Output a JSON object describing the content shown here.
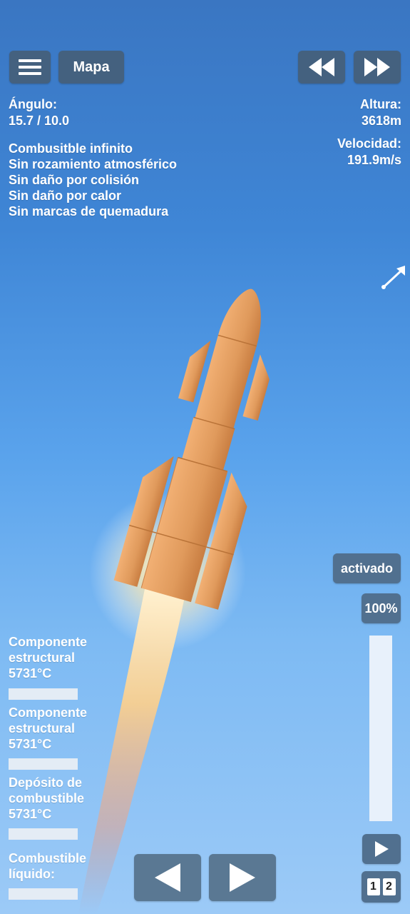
{
  "header": {
    "map_label": "Mapa"
  },
  "left_info": {
    "angle_label": "Ángulo:",
    "angle_value": "15.7 / 10.0",
    "cheats": [
      "Combusitble infinito",
      "Sin rozamiento atmosférico",
      "Sin daño por colisión",
      "Sin daño por calor",
      "Sin marcas de quemadura"
    ]
  },
  "right_info": {
    "altitude_label": "Altura:",
    "altitude_value": "3618m",
    "velocity_label": "Velocidad:",
    "velocity_value": "191.9m/s"
  },
  "controls": {
    "activated_label": "activado",
    "throttle_label": "100%",
    "throttle_level": 1.0,
    "stage_1": "1",
    "stage_2": "2"
  },
  "temperatures": [
    {
      "name_line1": "Componente",
      "name_line2": "estructural",
      "temp": "5731°C"
    },
    {
      "name_line1": "Componente",
      "name_line2": "estructural",
      "temp": "5731°C"
    },
    {
      "name_line1": "Depósito de",
      "name_line2": "combustible",
      "temp": "5731°C"
    },
    {
      "name_line1": "Combustible",
      "name_line2": "líquido:",
      "temp": ""
    }
  ],
  "icons": {
    "menu": "hamburger-icon",
    "rewind": "rewind-icon",
    "fast_forward": "fast-forward-icon",
    "direction": "direction-arrow-icon",
    "play": "play-icon",
    "rotate_left": "rotate-left-icon",
    "rotate_right": "rotate-right-icon"
  }
}
